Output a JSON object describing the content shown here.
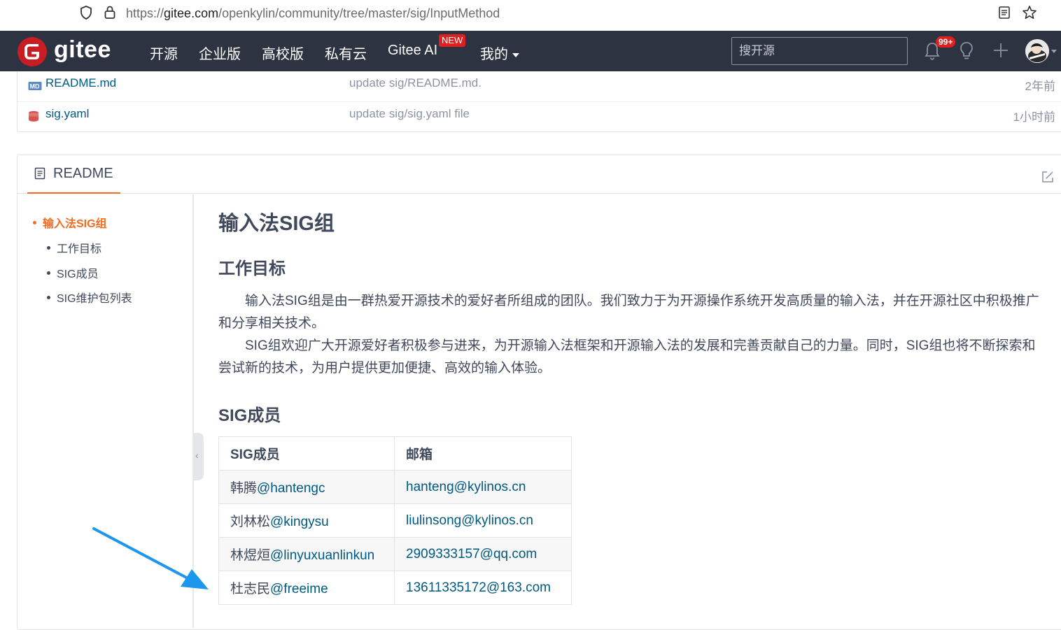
{
  "browser": {
    "url_prefix": "https://",
    "url_host": "gitee.com",
    "url_path": "/openkylin/community/tree/master/sig/InputMethod"
  },
  "nav": {
    "brand": "gitee",
    "menu": [
      "开源",
      "企业版",
      "高校版",
      "私有云",
      "Gitee AI",
      "我的"
    ],
    "new_badge": "NEW",
    "search_placeholder": "搜开源",
    "notification_count": "99+",
    "colors": {
      "bar": "#2d3340",
      "badge": "#e02020",
      "logo": "#c71d23"
    }
  },
  "files": [
    {
      "name": "README.md",
      "message": "update sig/README.md.",
      "time": "2年前",
      "icon": "markdown-icon"
    },
    {
      "name": "sig.yaml",
      "message": "update sig/sig.yaml file",
      "time": "1小时前",
      "icon": "database-icon"
    }
  ],
  "readme": {
    "tab_label": "README",
    "toc": [
      "输入法SIG组",
      "工作目标",
      "SIG成员",
      "SIG维护包列表"
    ],
    "title": "输入法SIG组",
    "section_goal": "工作目标",
    "paragraph1": "输入法SIG组是由一群热爱开源技术的爱好者所组成的团队。我们致力于为开源操作系统开发高质量的输入法，并在开源社区中积极推广和分享相关技术。",
    "paragraph2": "SIG组欢迎广大开源爱好者积极参与进来，为开源输入法框架和开源输入法的发展和完善贡献自己的力量。同时，SIG组也将不断探索和尝试新的技术，为用户提供更加便捷、高效的输入体验。",
    "section_members": "SIG成员",
    "table": {
      "headers": [
        "SIG成员",
        "邮箱"
      ],
      "rows": [
        {
          "name": "韩腾",
          "handle": "@hantengc",
          "email": "hanteng@kylinos.cn"
        },
        {
          "name": "刘林松",
          "handle": "@kingysu",
          "email": "liulinsong@kylinos.cn"
        },
        {
          "name": "林煜烜",
          "handle": "@linyuxuanlinkun",
          "email": "2909333157@qq.com"
        },
        {
          "name": "杜志民",
          "handle": "@freeime",
          "email": "13611335172@163.com"
        }
      ]
    },
    "accent_color": "#f36c22",
    "link_color": "#005980"
  },
  "annotation": {
    "arrow_color": "#1e96ee"
  }
}
